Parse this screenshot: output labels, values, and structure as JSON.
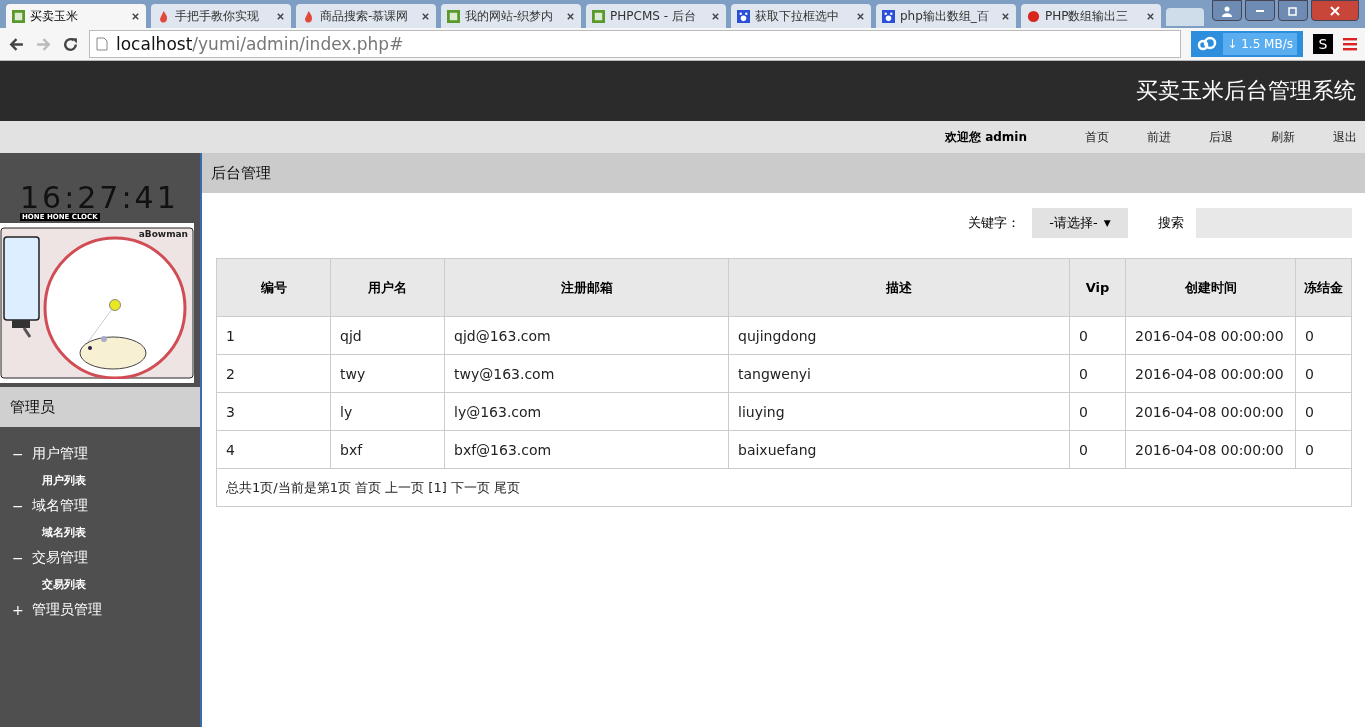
{
  "browser": {
    "tabs": [
      {
        "title": "买卖玉米",
        "kind": "green",
        "selected": true
      },
      {
        "title": "手把手教你实现",
        "kind": "flame",
        "selected": false
      },
      {
        "title": "商品搜索-慕课网",
        "kind": "flame",
        "selected": false
      },
      {
        "title": "我的网站-织梦内",
        "kind": "green",
        "selected": false
      },
      {
        "title": "PHPCMS - 后台",
        "kind": "green",
        "selected": false
      },
      {
        "title": "获取下拉框选中",
        "kind": "paw",
        "selected": false
      },
      {
        "title": "php输出数组_百",
        "kind": "paw",
        "selected": false
      },
      {
        "title": "PHP数组输出三",
        "kind": "red",
        "selected": false
      }
    ],
    "address_host": "localhost",
    "address_path": "/yumi/admin/index.php#",
    "speed": "↓ 1.5 MB/s",
    "ext_label": "S"
  },
  "header": {
    "title": "买卖玉米后台管理系统"
  },
  "nav": {
    "welcome": "欢迎您",
    "user": "admin",
    "links": [
      "首页",
      "前进",
      "后退",
      "刷新",
      "退出"
    ]
  },
  "sidebar": {
    "clock": {
      "time": "16:27:41",
      "caption": "HONE HONE CLOCK",
      "credit": "aBowman"
    },
    "section": "管理员",
    "menu": [
      {
        "sign": "−",
        "label": "用户管理",
        "children": [
          {
            "label": "用户列表"
          }
        ]
      },
      {
        "sign": "−",
        "label": "域名管理",
        "children": [
          {
            "label": "域名列表"
          }
        ]
      },
      {
        "sign": "−",
        "label": "交易管理",
        "children": [
          {
            "label": "交易列表"
          }
        ]
      },
      {
        "sign": "+",
        "label": "管理员管理"
      }
    ]
  },
  "main": {
    "title": "后台管理",
    "keyword_label": "关键字：",
    "select_value": "-请选择-",
    "select_caret": "▼",
    "search_label": "搜索",
    "table": {
      "columns": [
        "编号",
        "用户名",
        "注册邮箱",
        "描述",
        "Vip",
        "创建时间",
        "冻结金"
      ],
      "rows": [
        [
          "1",
          "qjd",
          "qjd@163.com",
          "qujingdong",
          "0",
          "2016-04-08 00:00:00",
          "0"
        ],
        [
          "2",
          "twy",
          "twy@163.com",
          "tangwenyi",
          "0",
          "2016-04-08 00:00:00",
          "0"
        ],
        [
          "3",
          "ly",
          "ly@163.com",
          "liuying",
          "0",
          "2016-04-08 00:00:00",
          "0"
        ],
        [
          "4",
          "bxf",
          "bxf@163.com",
          "baixuefang",
          "0",
          "2016-04-08 00:00:00",
          "0"
        ]
      ],
      "pager": "总共1页/当前是第1页 首页 上一页 [1] 下一页 尾页"
    }
  }
}
